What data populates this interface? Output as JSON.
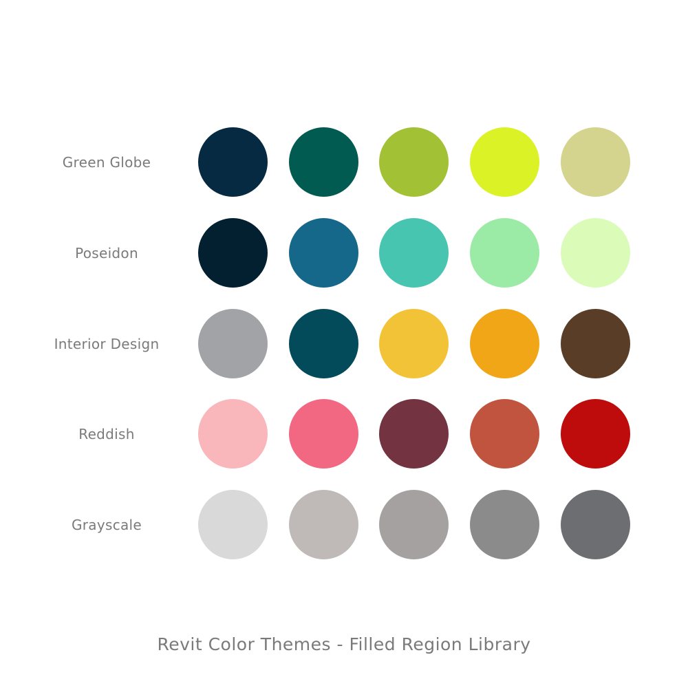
{
  "title": "Revit Color Themes - Filled Region Library",
  "themes": [
    {
      "name": "Green Globe",
      "colors": [
        "#062a42",
        "#025b51",
        "#a2c134",
        "#dbf226",
        "#d4d48e"
      ]
    },
    {
      "name": "Poseidon",
      "colors": [
        "#022030",
        "#15688a",
        "#47c5b0",
        "#9beba7",
        "#dbfcb9"
      ]
    },
    {
      "name": "Interior Design",
      "colors": [
        "#a2a3a6",
        "#034a5a",
        "#f2c336",
        "#f0a616",
        "#5a3d26"
      ]
    },
    {
      "name": "Reddish",
      "colors": [
        "#f9b7bc",
        "#f26882",
        "#733340",
        "#c0543e",
        "#be0c0c"
      ]
    },
    {
      "name": "Grayscale",
      "colors": [
        "#d9d9d9",
        "#bfbab7",
        "#a5a1a0",
        "#8b8b8b",
        "#6d6e71"
      ]
    }
  ]
}
